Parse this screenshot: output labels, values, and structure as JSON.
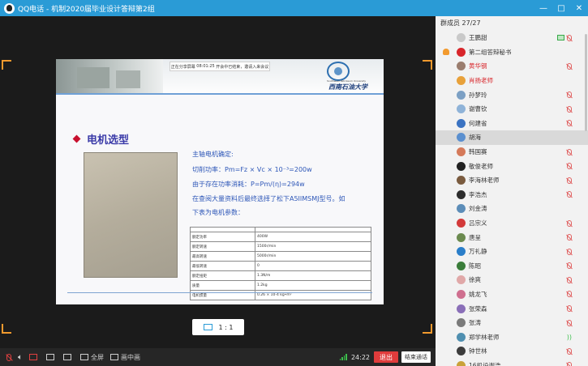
{
  "window": {
    "title": "QQ电话 - 机制2020届毕业设计答辩第2组",
    "controls": [
      "—",
      "□",
      "✕"
    ]
  },
  "slide": {
    "meeting_bar": {
      "label": "正在分享屏幕",
      "time": "08:01:25",
      "note": "开会中已结束，邀请入来会议"
    },
    "university_name": "西南石油大学",
    "university_en": "Southwest Petroleum University",
    "title": "电机选型",
    "lines": [
      "主轴电机确定:",
      "切削功率：Pm=Fz × Vc × 10⁻³=200w",
      "由于存在功率消耗：P=Pm/(η)=294w",
      "在查阅大量资料后最终选择了松下A5IIMSMJ型号。如",
      "下表为电机参数："
    ],
    "table": {
      "rows": [
        [
          "",
          ""
        ],
        [
          "额定功率",
          "400W"
        ],
        [
          "额定转速",
          "1500r/min"
        ],
        [
          "最高转速",
          "5000r/min"
        ],
        [
          "最低转速",
          "0"
        ],
        [
          "额定扭矩",
          "1.3N/m"
        ],
        [
          "质量",
          "1.2kg"
        ],
        [
          "电机惯量",
          "0.26 × 10-4 kg•m²"
        ]
      ]
    }
  },
  "zoom": {
    "label": "1 : 1"
  },
  "toolbar": {
    "fullscreen": "全屏",
    "pip": "画中画",
    "time": "24:22",
    "exit": "退出",
    "end_call": "结束通话"
  },
  "panel": {
    "title": "群成员 27/27",
    "members": [
      {
        "name": "王鹏甜",
        "color": "#c9c9c9",
        "red": false,
        "host": false,
        "status": "screen-muted"
      },
      {
        "name": "第二组答辩秘书",
        "color": "#d8252a",
        "red": false,
        "host": true,
        "status": "none"
      },
      {
        "name": "黄华钢",
        "color": "#9a7d6e",
        "red": true,
        "host": false,
        "status": "muted"
      },
      {
        "name": "肖扬老师",
        "color": "#e8a13a",
        "red": true,
        "host": false,
        "status": "none"
      },
      {
        "name": "孙梦玲",
        "color": "#7ca0c4",
        "red": false,
        "host": false,
        "status": "muted"
      },
      {
        "name": "谢曹钦",
        "color": "#8fb3d8",
        "red": false,
        "host": false,
        "status": "muted"
      },
      {
        "name": "何建省",
        "color": "#3b73c2",
        "red": false,
        "host": false,
        "status": "muted"
      },
      {
        "name": "胡海",
        "color": "#5a8fcf",
        "red": false,
        "host": false,
        "status": "none",
        "selected": true
      },
      {
        "name": "韩国赛",
        "color": "#d57a5a",
        "red": false,
        "host": false,
        "status": "muted"
      },
      {
        "name": "敬俊老师",
        "color": "#222222",
        "red": false,
        "host": false,
        "status": "muted"
      },
      {
        "name": "李海林老师",
        "color": "#7a5b3f",
        "red": false,
        "host": false,
        "status": "muted"
      },
      {
        "name": "李浩杰",
        "color": "#2c2c2c",
        "red": false,
        "host": false,
        "status": "muted"
      },
      {
        "name": "刘金涛",
        "color": "#5c8db8",
        "red": false,
        "host": false,
        "status": "none"
      },
      {
        "name": "吕宗义",
        "color": "#d33a3a",
        "red": false,
        "host": false,
        "status": "muted"
      },
      {
        "name": "唐呈",
        "color": "#6b8a4f",
        "red": false,
        "host": false,
        "status": "muted"
      },
      {
        "name": "万礼静",
        "color": "#2a7ec9",
        "red": false,
        "host": false,
        "status": "muted"
      },
      {
        "name": "陈昭",
        "color": "#3a7d3a",
        "red": false,
        "host": false,
        "status": "muted"
      },
      {
        "name": "徐爽",
        "color": "#e0a8a8",
        "red": false,
        "host": false,
        "status": "muted"
      },
      {
        "name": "姚龙飞",
        "color": "#cf6f8f",
        "red": false,
        "host": false,
        "status": "muted"
      },
      {
        "name": "张荣森",
        "color": "#8a6fb8",
        "red": false,
        "host": false,
        "status": "muted"
      },
      {
        "name": "张涛",
        "color": "#7a7a7a",
        "red": false,
        "host": false,
        "status": "muted"
      },
      {
        "name": "郑学林老师",
        "color": "#4f8fb0",
        "red": false,
        "host": false,
        "status": "speaking"
      },
      {
        "name": "钟世林",
        "color": "#3c3c3c",
        "red": false,
        "host": false,
        "status": "muted"
      },
      {
        "name": "16机设谢浩",
        "color": "#c9a23a",
        "red": false,
        "host": false,
        "status": "muted"
      }
    ]
  }
}
